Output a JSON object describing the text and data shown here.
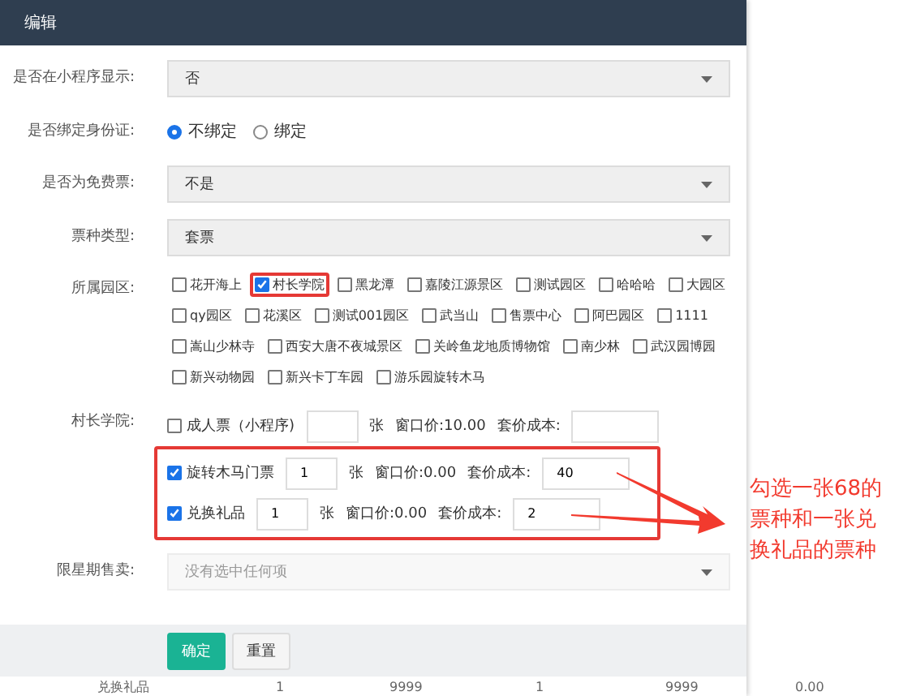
{
  "dialog": {
    "title": "编辑"
  },
  "fields": [
    {
      "kind": "select",
      "label": "是否在小程序显示:",
      "value": "否",
      "disabled": false
    },
    {
      "kind": "radio",
      "label": "是否绑定身份证:",
      "options": [
        {
          "label": "不绑定",
          "selected": true
        },
        {
          "label": "绑定",
          "selected": false
        }
      ]
    },
    {
      "kind": "select",
      "label": "是否为免费票:",
      "value": "不是",
      "disabled": false
    },
    {
      "kind": "select",
      "label": "票种类型:",
      "value": "套票",
      "disabled": false
    },
    {
      "kind": "checkboxes",
      "label": "所属园区:",
      "options": [
        {
          "label": "花开海上",
          "checked": false,
          "highlighted": false
        },
        {
          "label": "村长学院",
          "checked": true,
          "highlighted": true
        },
        {
          "label": "黑龙潭",
          "checked": false,
          "highlighted": false
        },
        {
          "label": "嘉陵江源景区",
          "checked": false,
          "highlighted": false
        },
        {
          "label": "测试园区",
          "checked": false,
          "highlighted": false
        },
        {
          "label": "哈哈哈",
          "checked": false,
          "highlighted": false
        },
        {
          "label": "大园区",
          "checked": false,
          "highlighted": false
        },
        {
          "label": "qy园区",
          "checked": false,
          "highlighted": false
        },
        {
          "label": "花溪区",
          "checked": false,
          "highlighted": false
        },
        {
          "label": "测试001园区",
          "checked": false,
          "highlighted": false
        },
        {
          "label": "武当山",
          "checked": false,
          "highlighted": false
        },
        {
          "label": "售票中心",
          "checked": false,
          "highlighted": false
        },
        {
          "label": "阿巴园区",
          "checked": false,
          "highlighted": false
        },
        {
          "label": "1111",
          "checked": false,
          "highlighted": false
        },
        {
          "label": "嵩山少林寺",
          "checked": false,
          "highlighted": false
        },
        {
          "label": "西安大唐不夜城景区",
          "checked": false,
          "highlighted": false
        },
        {
          "label": "关岭鱼龙地质博物馆",
          "checked": false,
          "highlighted": false
        },
        {
          "label": "南少林",
          "checked": false,
          "highlighted": false
        },
        {
          "label": "武汉园博园",
          "checked": false,
          "highlighted": false
        },
        {
          "label": "新兴动物园",
          "checked": false,
          "highlighted": false
        },
        {
          "label": "新兴卡丁车园",
          "checked": false,
          "highlighted": false
        },
        {
          "label": "游乐园旋转木马",
          "checked": false,
          "highlighted": false
        }
      ]
    },
    {
      "kind": "tickets",
      "label": "村长学院:",
      "tickets": [
        {
          "name": "成人票（小程序)",
          "checked": false,
          "highlighted": false,
          "unit": "张",
          "window_price": "窗口价:10.00",
          "cost_label": "套价成本:"
        },
        {
          "name": "旋转木马门票",
          "checked": true,
          "highlighted": true,
          "quantity": "1",
          "unit": "张",
          "window_price": "窗口价:0.00",
          "cost_label": "套价成本:",
          "cost": "40"
        },
        {
          "name": "兑换礼品",
          "checked": true,
          "highlighted": true,
          "quantity": "1",
          "unit": "张",
          "window_price": "窗口价:0.00",
          "cost_label": "套价成本:",
          "cost": "2"
        }
      ]
    },
    {
      "kind": "select",
      "label": "限星期售卖:",
      "placeholder": "没有选中任何项",
      "disabled": true
    }
  ],
  "buttons": [
    {
      "label": "确定",
      "kind": "primary"
    },
    {
      "label": "重置",
      "kind": "default"
    }
  ],
  "annotation": {
    "text": "勾选一张68的票种和一张兑换礼品的票种"
  },
  "background_row": [
    "兑换礼品",
    "1",
    "9999",
    "1",
    "9999",
    "0.00"
  ]
}
